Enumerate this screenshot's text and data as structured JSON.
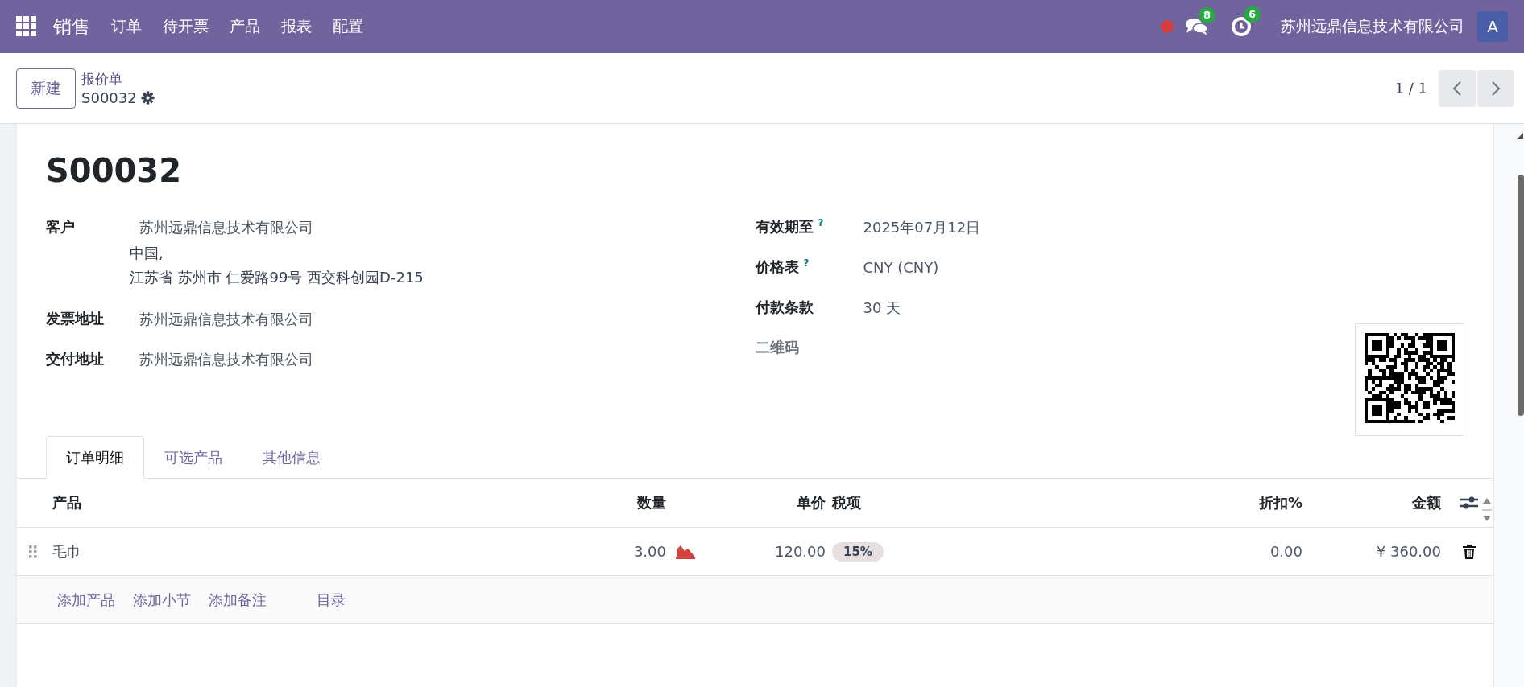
{
  "navbar": {
    "app": "销售",
    "menu": [
      "订单",
      "待开票",
      "产品",
      "报表",
      "配置"
    ],
    "messages_count": "8",
    "activities_count": "6",
    "company": "苏州远鼎信息技术有限公司",
    "avatar": "A"
  },
  "control_panel": {
    "new_button": "新建",
    "breadcrumb": "报价单",
    "record": "S00032",
    "pager": "1 / 1"
  },
  "form": {
    "title": "S00032",
    "left_fields": [
      {
        "label": "客户",
        "value": "苏州远鼎信息技术有限公司",
        "address": [
          "中国,",
          "江苏省 苏州市 仁爱路99号 西交科创园D-215"
        ]
      },
      {
        "label": "发票地址",
        "value": "苏州远鼎信息技术有限公司"
      },
      {
        "label": "交付地址",
        "value": "苏州远鼎信息技术有限公司"
      }
    ],
    "right_fields": [
      {
        "kind": "text",
        "label": "有效期至",
        "help": "?",
        "value": "2025年07月12日"
      },
      {
        "kind": "text",
        "label": "价格表",
        "help": "?",
        "value": "CNY (CNY)"
      },
      {
        "kind": "text",
        "label": "付款条款",
        "value": "30 天"
      },
      {
        "kind": "qr",
        "label": "二维码"
      }
    ]
  },
  "tabs": [
    {
      "label": "订单明细",
      "selected": true
    },
    {
      "label": "可选产品",
      "selected": false
    },
    {
      "label": "其他信息",
      "selected": false
    }
  ],
  "order_lines": {
    "columns": [
      "产品",
      "数量",
      "单价",
      "税项",
      "折扣%",
      "金额"
    ],
    "rows": [
      {
        "product": "毛巾",
        "quantity": "3.00",
        "unit_price": "120.00",
        "taxes": [
          "15%"
        ],
        "discount": "0.00",
        "amount": "¥ 360.00"
      }
    ],
    "add_links": [
      "添加产品",
      "添加小节",
      "添加备注",
      "目录"
    ]
  }
}
